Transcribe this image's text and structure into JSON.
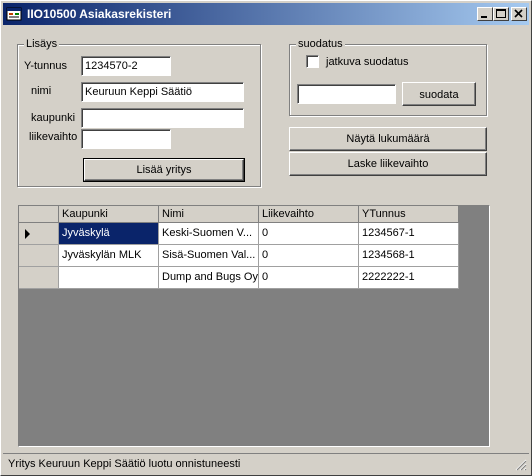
{
  "window": {
    "title": "IIO10500 Asiakasrekisteri",
    "app_icon": "form-icon",
    "controls": [
      "minimize-icon",
      "maximize-icon",
      "close-icon"
    ]
  },
  "lisays": {
    "legend": "Lisäys",
    "ytunnus_label": "Y-tunnus",
    "ytunnus_value": "1234570-2",
    "nimi_label": "nimi",
    "nimi_value": "Keuruun Keppi Säätiö",
    "kaupunki_label": "kaupunki",
    "kaupunki_value": "",
    "liikevaihto_label": "liikevaihto",
    "liikevaihto_value": "",
    "add_button": "Lisää yritys"
  },
  "suodatus": {
    "legend": "suodatus",
    "checkbox_label": "jatkuva suodatus",
    "checked": false,
    "filter_value": "",
    "filter_button": "suodata"
  },
  "actions": {
    "show_count": "Näytä lukumäärä",
    "sum_revenue": "Laske liikevaihto"
  },
  "grid": {
    "columns": [
      "Kaupunki",
      "Nimi",
      "Liikevaihto",
      "YTunnus"
    ],
    "rows": [
      [
        "Jyväskylä",
        "Keski-Suomen V...",
        "0",
        "1234567-1"
      ],
      [
        "Jyväskylän MLK",
        "Sisä-Suomen Val...",
        "0",
        "1234568-1"
      ],
      [
        "",
        "Dump and Bugs Oy",
        "0",
        "2222222-1"
      ]
    ],
    "current_row_marker": "row-pointer-icon"
  },
  "status": {
    "text": "Yritys Keuruun Keppi Säätiö luotu onnistuneesti"
  },
  "colors": {
    "titlebar_start": "#0a246a",
    "titlebar_end": "#a6caf0",
    "selection": "#0a246a",
    "face": "#d4d0c8"
  }
}
